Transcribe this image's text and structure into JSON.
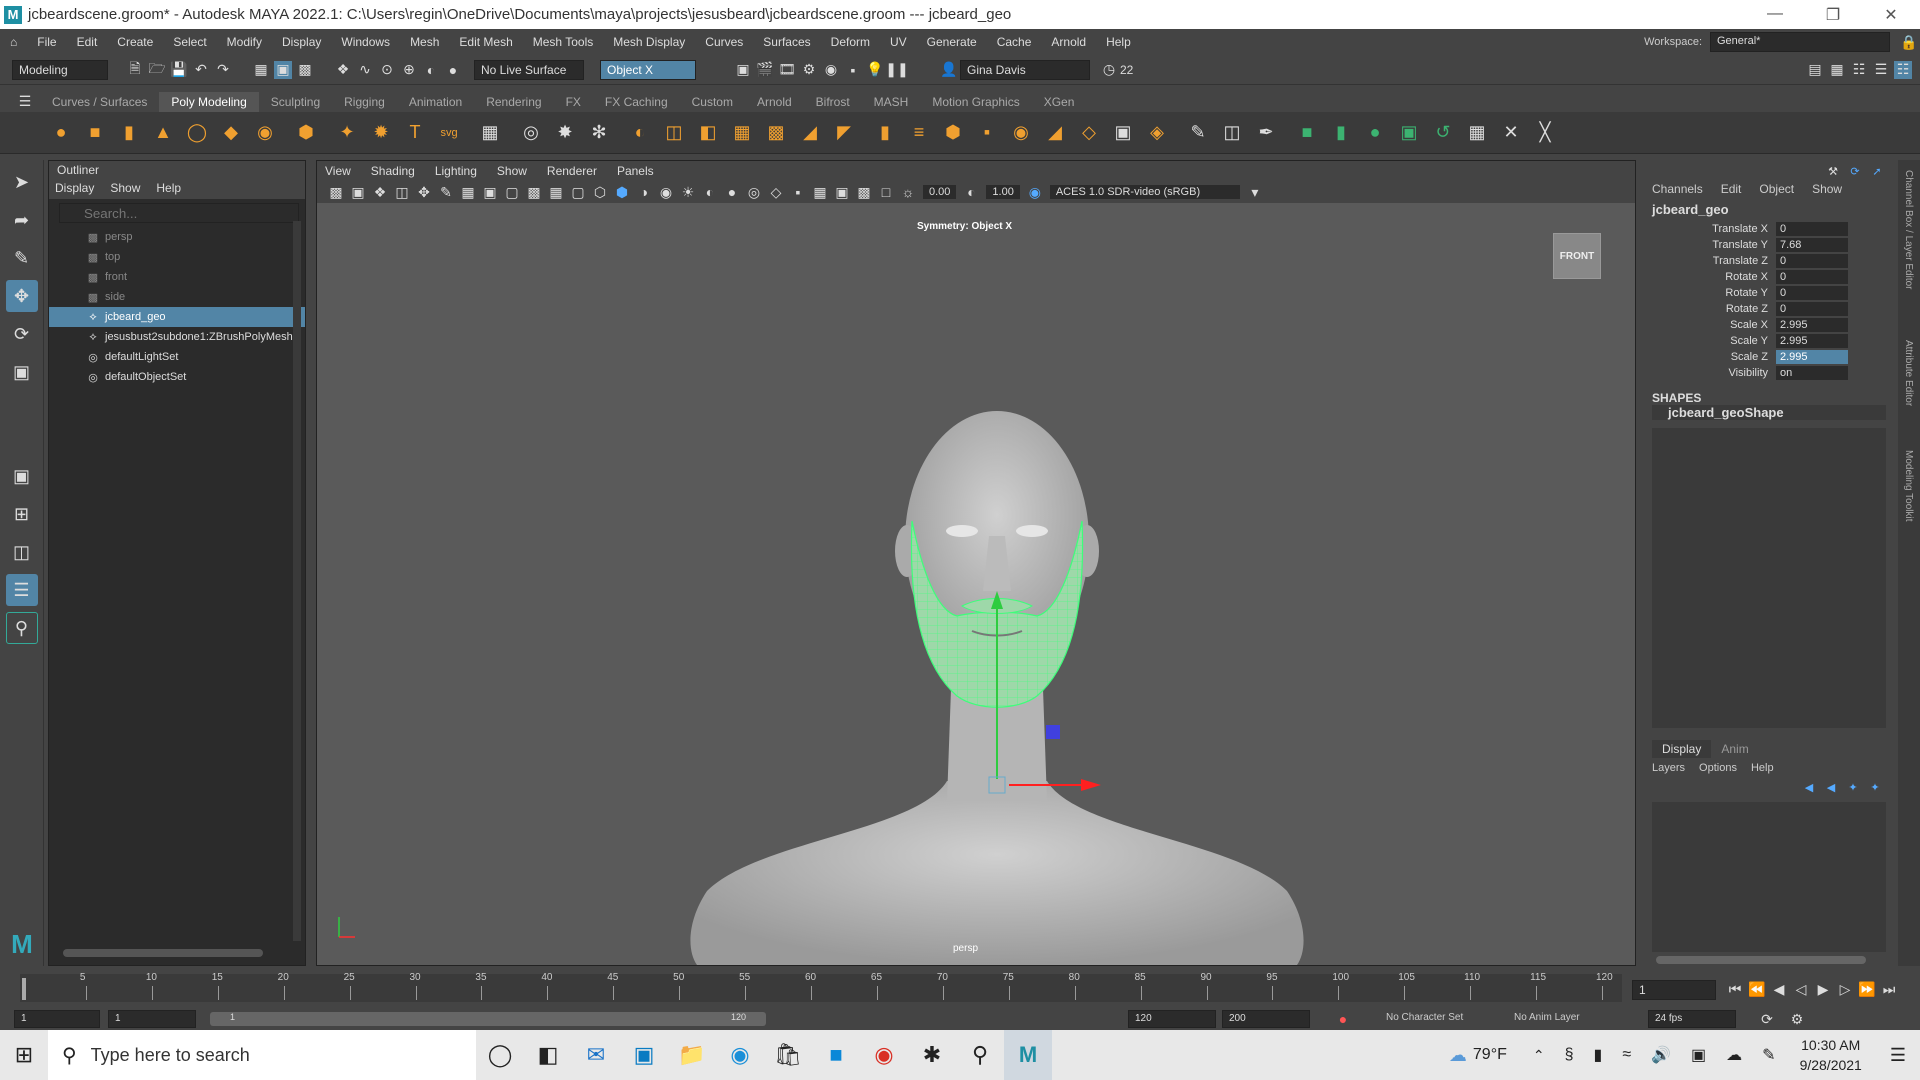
{
  "titlebar": {
    "title": "jcbeardscene.groom* - Autodesk MAYA 2022.1: C:\\Users\\regin\\OneDrive\\Documents\\maya\\projects\\jesusbeard\\jcbeardscene.groom    ---   jcbeard_geo"
  },
  "menubar": {
    "items": [
      "File",
      "Edit",
      "Create",
      "Select",
      "Modify",
      "Display",
      "Windows",
      "Mesh",
      "Edit Mesh",
      "Mesh Tools",
      "Mesh Display",
      "Curves",
      "Surfaces",
      "Deform",
      "UV",
      "Generate",
      "Cache",
      "Arnold",
      "Help"
    ],
    "workspace_label": "Workspace:",
    "workspace_value": "General*"
  },
  "statusline": {
    "menuset": "Modeling",
    "live_surface": "No Live Surface",
    "symmetry": "Object X",
    "user": "Gina Davis",
    "notifications": "22"
  },
  "shelf": {
    "tabs": [
      "Curves / Surfaces",
      "Poly Modeling",
      "Sculpting",
      "Rigging",
      "Animation",
      "Rendering",
      "FX",
      "FX Caching",
      "Custom",
      "Arnold",
      "Bifrost",
      "MASH",
      "Motion Graphics",
      "XGen"
    ],
    "active": "Poly Modeling"
  },
  "outliner": {
    "title": "Outliner",
    "menu": [
      "Display",
      "Show",
      "Help"
    ],
    "search_placeholder": "Search...",
    "items": [
      {
        "label": "persp",
        "type": "camera"
      },
      {
        "label": "top",
        "type": "camera"
      },
      {
        "label": "front",
        "type": "camera"
      },
      {
        "label": "side",
        "type": "camera"
      },
      {
        "label": "jcbeard_geo",
        "type": "mesh",
        "selected": true
      },
      {
        "label": "jesusbust2subdone1:ZBrushPolyMesh",
        "type": "mesh"
      },
      {
        "label": "defaultLightSet",
        "type": "set"
      },
      {
        "label": "defaultObjectSet",
        "type": "set"
      }
    ]
  },
  "viewport": {
    "menu": [
      "View",
      "Shading",
      "Lighting",
      "Show",
      "Renderer",
      "Panels"
    ],
    "exposure": "0.00",
    "gamma": "1.00",
    "colorspace": "ACES 1.0 SDR-video (sRGB)",
    "hud_symmetry": "Symmetry: Object X",
    "viewcube": "FRONT",
    "camera": "persp"
  },
  "channelbox": {
    "menu": [
      "Channels",
      "Edit",
      "Object",
      "Show"
    ],
    "object": "jcbeard_geo",
    "channels": [
      {
        "name": "Translate X",
        "value": "0"
      },
      {
        "name": "Translate Y",
        "value": "7.68"
      },
      {
        "name": "Translate Z",
        "value": "0"
      },
      {
        "name": "Rotate X",
        "value": "0"
      },
      {
        "name": "Rotate Y",
        "value": "0"
      },
      {
        "name": "Rotate Z",
        "value": "0"
      },
      {
        "name": "Scale X",
        "value": "2.995"
      },
      {
        "name": "Scale Y",
        "value": "2.995"
      },
      {
        "name": "Scale Z",
        "value": "2.995",
        "selected": true
      },
      {
        "name": "Visibility",
        "value": "on"
      }
    ],
    "shapes_label": "SHAPES",
    "shape": "jcbeard_geoShape"
  },
  "layers": {
    "tabs": [
      "Display",
      "Anim"
    ],
    "menu": [
      "Layers",
      "Options",
      "Help"
    ]
  },
  "sidetabs": [
    "Channel Box / Layer Editor",
    "Attribute Editor",
    "Modeling Toolkit"
  ],
  "timeline": {
    "ticks": [
      "5",
      "10",
      "15",
      "20",
      "25",
      "30",
      "35",
      "40",
      "45",
      "50",
      "55",
      "60",
      "65",
      "70",
      "75",
      "80",
      "85",
      "90",
      "95",
      "100",
      "105",
      "110",
      "115",
      "120"
    ],
    "current_frame": "1"
  },
  "rangebar": {
    "start": "1",
    "range_start": "1",
    "range_end": "120",
    "end": "120",
    "anim_end": "200",
    "character_set": "No Character Set",
    "anim_layer": "No Anim Layer",
    "fps": "24 fps"
  },
  "taskbar": {
    "search_placeholder": "Type here to search",
    "weather": "79°F",
    "time": "10:30 AM",
    "date": "9/28/2021"
  }
}
